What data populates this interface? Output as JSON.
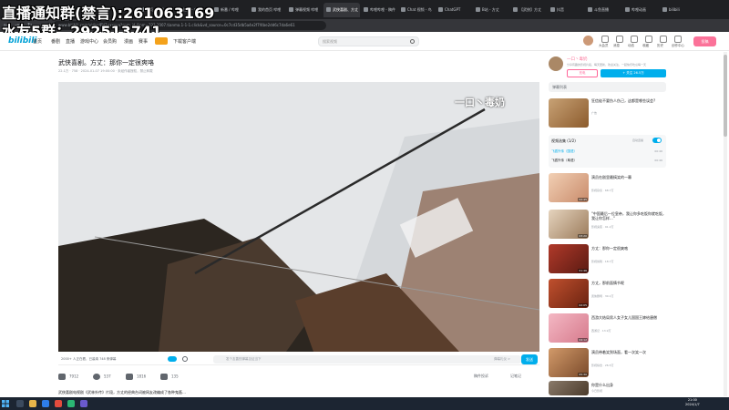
{
  "overlay": {
    "line1": "直播通知群(禁言):261063169",
    "line2": "水友5群：292513741"
  },
  "browser": {
    "tabs": [
      "首页 / 哔哩",
      "搜索 - 哔哩",
      "新番 / 哔哩",
      "我的首页 哔哩",
      "弹幕视频 哔哩",
      "武侠喜剧、方丈",
      "哔哩哔哩 - 稿件",
      "Chat 视频 - 鸟",
      "ChatGPT",
      "B站 - 方丈",
      "【武侠】方丈",
      "抖音",
      "斗鱼直播",
      "哔哩动画",
      "bilibili"
    ],
    "url": "www.bilibili.com/video/BV1xxxxxx?spm_id_from=333.1007.tianma.1-1-1.click&vd_source=0c7cd35db5a4e2f7f4be2dd6c7da6e61"
  },
  "header": {
    "logo": "bilibili",
    "nav": [
      "首页",
      "番剧",
      "直播",
      "游戏中心",
      "会员购",
      "漫画",
      "赛事",
      "",
      "下载客户端"
    ],
    "search_placeholder": "搜索视频",
    "user_icons": [
      "大会员",
      "消息",
      "动态",
      "收藏",
      "历史",
      "创作中心"
    ],
    "upload": "投稿"
  },
  "video": {
    "title": "武侠喜剧。方丈：那你一定很爽咯",
    "meta": "22.1万 · 758 · 2024-01-07 19:00:00 · 未经作者授权，禁止转载",
    "watermark": "一口丶毒奶",
    "viewers": "2000+ 人正在看，已装填 748 条弹幕",
    "danmaku_placeholder": "发个友善的弹幕见证当下",
    "etiquette": "弹幕礼仪 >",
    "send": "发送",
    "actions": [
      {
        "name": "like",
        "label": "7912"
      },
      {
        "name": "coin",
        "label": "537"
      },
      {
        "name": "favorite",
        "label": "1816"
      },
      {
        "name": "share",
        "label": "135"
      }
    ],
    "report": "稿件投诉",
    "notes": "记笔记",
    "desc": "武侠喜剧电视剧《武林外传》片段，方丈的经典台词被网友改编成了各种鬼畜…"
  },
  "uploader": {
    "name": "一口丶毒奶",
    "desc": "分享有趣的影视片段，每天更新，欢迎关注，一起快乐吃瓜每一天",
    "charge": "充电",
    "follow": "+ 关注 26.5万"
  },
  "sidebar": {
    "danmaku_list": "弹幕列表",
    "ad": {
      "title": "狂信徒不要伤人伤己，这都是哪些误会?",
      "meta": "广告"
    },
    "playlist": {
      "title": "视频选集 (1/2)",
      "autoplay": "自动连播",
      "items": [
        {
          "label": "飞狐外传（国语）",
          "dur": "00:46"
        },
        {
          "label": "飞狐外传（粤语）",
          "dur": "00:46"
        }
      ]
    },
    "recs": [
      {
        "title": "演员在剧里最搞笑的一幕",
        "meta": "影视杂谈 · 68.7万",
        "dur": "02:45"
      },
      {
        "title": "\"中国最后一位皇帝，我让你多吃饭你就吃饭，我让你怎样...\"",
        "meta": "影视鬼畜 · 91.2万",
        "dur": "03:20"
      },
      {
        "title": "方丈：那你一定很爽咯",
        "meta": "影视剪辑 · 18.7万",
        "dur": "01:46"
      },
      {
        "title": "方丈，那前面情节呢",
        "meta": "武侠剧场 · 30.1万",
        "dur": "02:05"
      },
      {
        "title": "西游大结局男人女子女儿国国王嫁给唐僧",
        "meta": "西游记 · 13.9万",
        "dur": "04:12"
      },
      {
        "title": "演员带着笑到场面，看一次笑一次",
        "meta": "影视综合 · 26.5万",
        "dur": "05:30"
      },
      {
        "title": "你是什么出身",
        "meta": "今日影视",
        "dur": ""
      }
    ]
  },
  "taskbar": {
    "time": "21:00",
    "date": "2024/1/7"
  }
}
